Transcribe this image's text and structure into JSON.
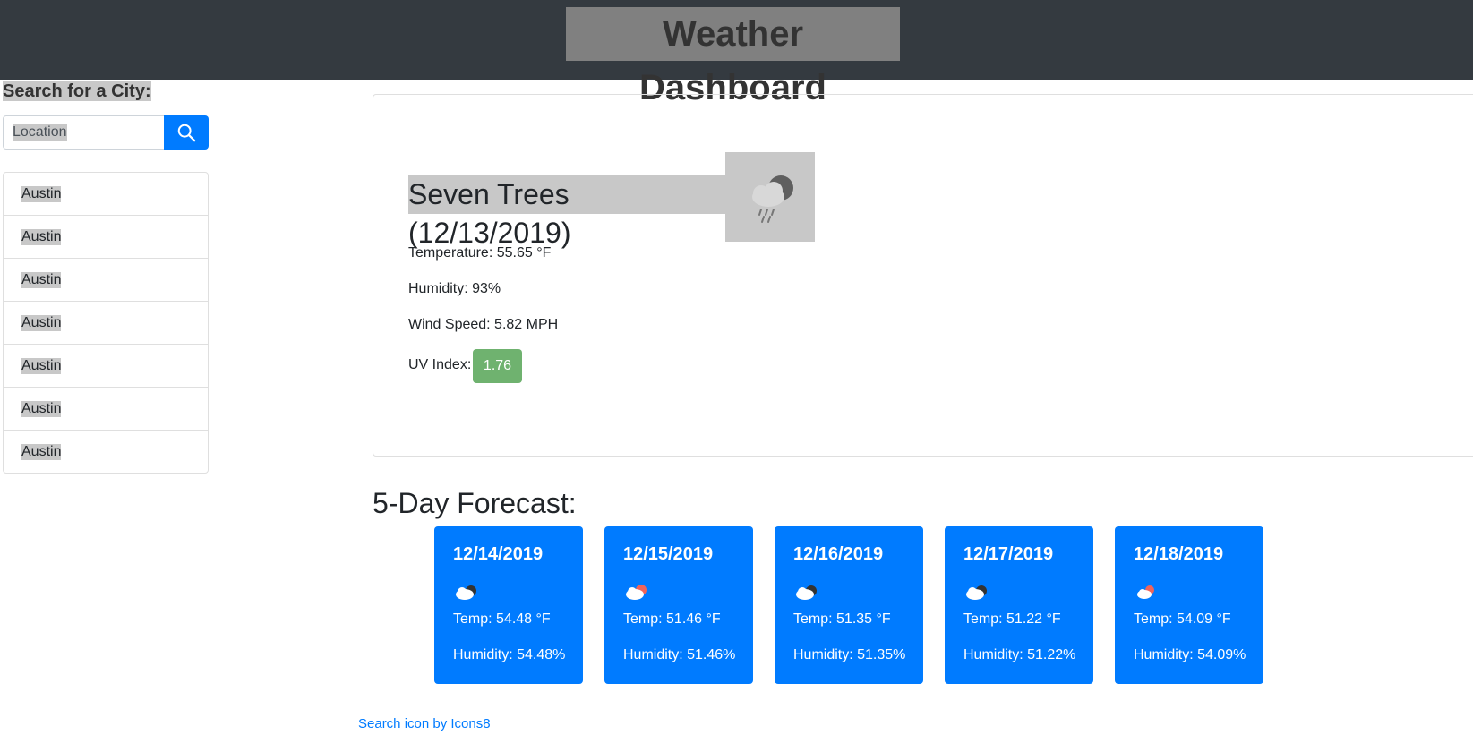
{
  "header": {
    "title": "Weather Dashboard"
  },
  "search": {
    "heading": "Search for a City:",
    "input_value": "Location",
    "button_icon": "search-icon"
  },
  "history": [
    "Austin",
    "Austin",
    "Austin",
    "Austin",
    "Austin",
    "Austin",
    "Austin"
  ],
  "current": {
    "title": "Seven Trees (12/13/2019)",
    "icon": "rain-cloud-moon-icon",
    "temperature": "Temperature: 55.65 °F",
    "humidity": "Humidity: 93%",
    "wind": "Wind Speed: 5.82 MPH",
    "uv_label": "UV Index:",
    "uv_value": "1.76",
    "uv_color": "#6fb26f"
  },
  "forecast": {
    "heading": "5-Day Forecast:",
    "days": [
      {
        "date": "12/14/2019",
        "icon": "cloud-moon-icon",
        "temp": "Temp: 54.48 °F",
        "humidity": "Humidity: 54.48%"
      },
      {
        "date": "12/15/2019",
        "icon": "cloud-sun-icon",
        "temp": "Temp: 51.46 °F",
        "humidity": "Humidity: 51.46%"
      },
      {
        "date": "12/16/2019",
        "icon": "cloud-moon-icon",
        "temp": "Temp: 51.35 °F",
        "humidity": "Humidity: 51.35%"
      },
      {
        "date": "12/17/2019",
        "icon": "cloud-moon-icon",
        "temp": "Temp: 51.22 °F",
        "humidity": "Humidity: 51.22%"
      },
      {
        "date": "12/18/2019",
        "icon": "cloud-sun-icon",
        "temp": "Temp: 54.09 °F",
        "humidity": "Humidity: 54.09%"
      }
    ]
  },
  "footer": {
    "credit": "Search icon by Icons8"
  },
  "colors": {
    "header_bg": "#343a40",
    "accent": "#007bff"
  }
}
